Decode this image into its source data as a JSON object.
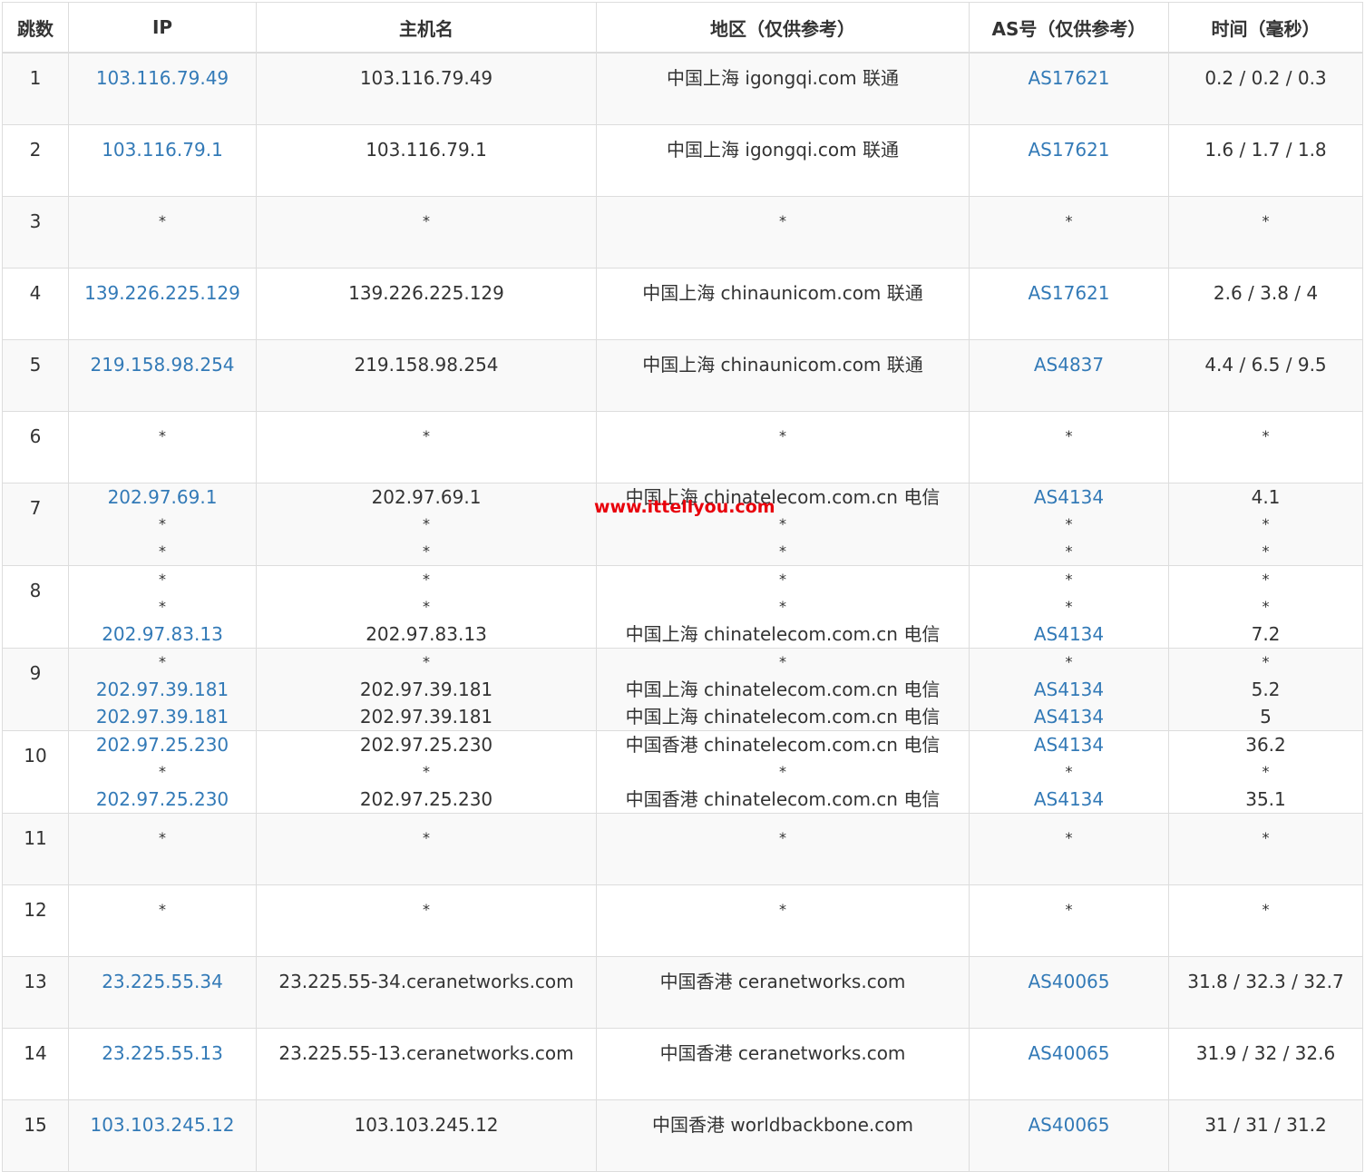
{
  "columns": [
    "跳数",
    "IP",
    "主机名",
    "地区（仅供参考）",
    "AS号（仅供参考）",
    "时间（毫秒）"
  ],
  "hops": [
    {
      "hop": "1",
      "lines": [
        {
          "ip": "103.116.79.49",
          "host": "103.116.79.49",
          "region": "中国上海 igongqi.com 联通",
          "as": "AS17621",
          "time": "0.2 / 0.2 / 0.3"
        }
      ]
    },
    {
      "hop": "2",
      "lines": [
        {
          "ip": "103.116.79.1",
          "host": "103.116.79.1",
          "region": "中国上海 igongqi.com 联通",
          "as": "AS17621",
          "time": "1.6 / 1.7 / 1.8"
        }
      ]
    },
    {
      "hop": "3",
      "lines": [
        {
          "ip": "*",
          "host": "*",
          "region": "*",
          "as": "*",
          "time": "*"
        }
      ]
    },
    {
      "hop": "4",
      "lines": [
        {
          "ip": "139.226.225.129",
          "host": "139.226.225.129",
          "region": "中国上海 chinaunicom.com 联通",
          "as": "AS17621",
          "time": "2.6 / 3.8 / 4"
        }
      ]
    },
    {
      "hop": "5",
      "lines": [
        {
          "ip": "219.158.98.254",
          "host": "219.158.98.254",
          "region": "中国上海 chinaunicom.com 联通",
          "as": "AS4837",
          "time": "4.4 / 6.5 / 9.5"
        }
      ]
    },
    {
      "hop": "6",
      "lines": [
        {
          "ip": "*",
          "host": "*",
          "region": "*",
          "as": "*",
          "time": "*"
        }
      ]
    },
    {
      "hop": "7",
      "lines": [
        {
          "ip": "202.97.69.1",
          "host": "202.97.69.1",
          "region": "中国上海 chinatelecom.com.cn 电信",
          "as": "AS4134",
          "time": "4.1"
        },
        {
          "ip": "*",
          "host": "*",
          "region": "*",
          "as": "*",
          "time": "*"
        },
        {
          "ip": "*",
          "host": "*",
          "region": "*",
          "as": "*",
          "time": "*"
        }
      ]
    },
    {
      "hop": "8",
      "lines": [
        {
          "ip": "*",
          "host": "*",
          "region": "*",
          "as": "*",
          "time": "*"
        },
        {
          "ip": "*",
          "host": "*",
          "region": "*",
          "as": "*",
          "time": "*"
        },
        {
          "ip": "202.97.83.13",
          "host": "202.97.83.13",
          "region": "中国上海 chinatelecom.com.cn 电信",
          "as": "AS4134",
          "time": "7.2"
        }
      ]
    },
    {
      "hop": "9",
      "lines": [
        {
          "ip": "*",
          "host": "*",
          "region": "*",
          "as": "*",
          "time": "*"
        },
        {
          "ip": "202.97.39.181",
          "host": "202.97.39.181",
          "region": "中国上海 chinatelecom.com.cn 电信",
          "as": "AS4134",
          "time": "5.2"
        },
        {
          "ip": "202.97.39.181",
          "host": "202.97.39.181",
          "region": "中国上海 chinatelecom.com.cn 电信",
          "as": "AS4134",
          "time": "5"
        }
      ]
    },
    {
      "hop": "10",
      "lines": [
        {
          "ip": "202.97.25.230",
          "host": "202.97.25.230",
          "region": "中国香港 chinatelecom.com.cn 电信",
          "as": "AS4134",
          "time": "36.2"
        },
        {
          "ip": "*",
          "host": "*",
          "region": "*",
          "as": "*",
          "time": "*"
        },
        {
          "ip": "202.97.25.230",
          "host": "202.97.25.230",
          "region": "中国香港 chinatelecom.com.cn 电信",
          "as": "AS4134",
          "time": "35.1"
        }
      ]
    },
    {
      "hop": "11",
      "lines": [
        {
          "ip": "*",
          "host": "*",
          "region": "*",
          "as": "*",
          "time": "*"
        }
      ]
    },
    {
      "hop": "12",
      "lines": [
        {
          "ip": "*",
          "host": "*",
          "region": "*",
          "as": "*",
          "time": "*"
        }
      ]
    },
    {
      "hop": "13",
      "lines": [
        {
          "ip": "23.225.55.34",
          "host": "23.225.55-34.ceranetworks.com",
          "region": "中国香港 ceranetworks.com",
          "as": "AS40065",
          "time": "31.8 / 32.3 / 32.7"
        }
      ]
    },
    {
      "hop": "14",
      "lines": [
        {
          "ip": "23.225.55.13",
          "host": "23.225.55-13.ceranetworks.com",
          "region": "中国香港 ceranetworks.com",
          "as": "AS40065",
          "time": "31.9 / 32 / 32.6"
        }
      ]
    },
    {
      "hop": "15",
      "lines": [
        {
          "ip": "103.103.245.12",
          "host": "103.103.245.12",
          "region": "中国香港 worldbackbone.com",
          "as": "AS40065",
          "time": "31 / 31 / 31.2"
        }
      ]
    }
  ],
  "watermark": "www.ittellyou.com",
  "colors": {
    "link": "#337ab7",
    "watermark": "#e8000b",
    "stripe": "#f9f9f9",
    "border": "#dddddd"
  }
}
